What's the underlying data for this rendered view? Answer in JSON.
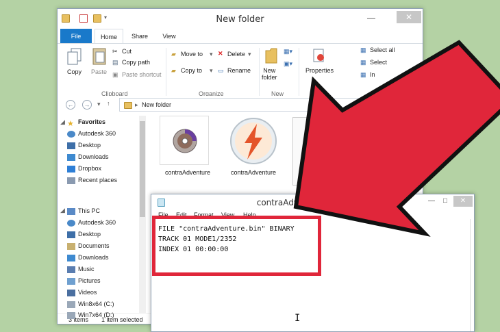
{
  "explorer": {
    "title": "New folder",
    "minimize": "—",
    "close": "✕",
    "tabs": {
      "file": "File",
      "home": "Home",
      "share": "Share",
      "view": "View"
    },
    "clipboard": {
      "copy": "Copy",
      "paste": "Paste",
      "cut": "Cut",
      "copy_path": "Copy path",
      "paste_shortcut": "Paste shortcut",
      "label": "Clipboard"
    },
    "organize": {
      "move_to": "Move to",
      "copy_to": "Copy to",
      "delete": "Delete",
      "rename": "Rename",
      "label": "Organize"
    },
    "new": {
      "new_folder": "New\nfolder",
      "label": "New"
    },
    "open": {
      "properties": "Properties",
      "label": "O"
    },
    "select": {
      "select_all": "Select all",
      "select_none": "Select",
      "invert": "In"
    },
    "address": {
      "path": "New folder"
    },
    "nav": {
      "favorites": "Favorites",
      "favorites_items": [
        "Autodesk 360",
        "Desktop",
        "Downloads",
        "Dropbox",
        "Recent places"
      ],
      "this_pc": "This PC",
      "this_pc_items": [
        "Autodesk 360",
        "Desktop",
        "Documents",
        "Downloads",
        "Music",
        "Pictures",
        "Videos",
        "Win8x64 (C:)",
        "Win7x64 (D:)"
      ]
    },
    "files": [
      {
        "name": "contraAdventure"
      },
      {
        "name": "contraAdventure"
      }
    ],
    "status": {
      "count": "3 items",
      "selected": "1 item selected"
    }
  },
  "notepad": {
    "title": "contraAdventure - Notepad",
    "menu": [
      "File",
      "Edit",
      "Format",
      "View",
      "Help"
    ],
    "lines": [
      "FILE \"contraAdventure.bin\" BINARY",
      "TRACK 01 MODE1/2352",
      "INDEX 01 00:00:00"
    ],
    "minimize": "—",
    "maximize": "□",
    "close": "✕"
  },
  "colors": {
    "background": "#b4d2a4",
    "accent": "#1979ca",
    "highlight": "#e0263a"
  }
}
